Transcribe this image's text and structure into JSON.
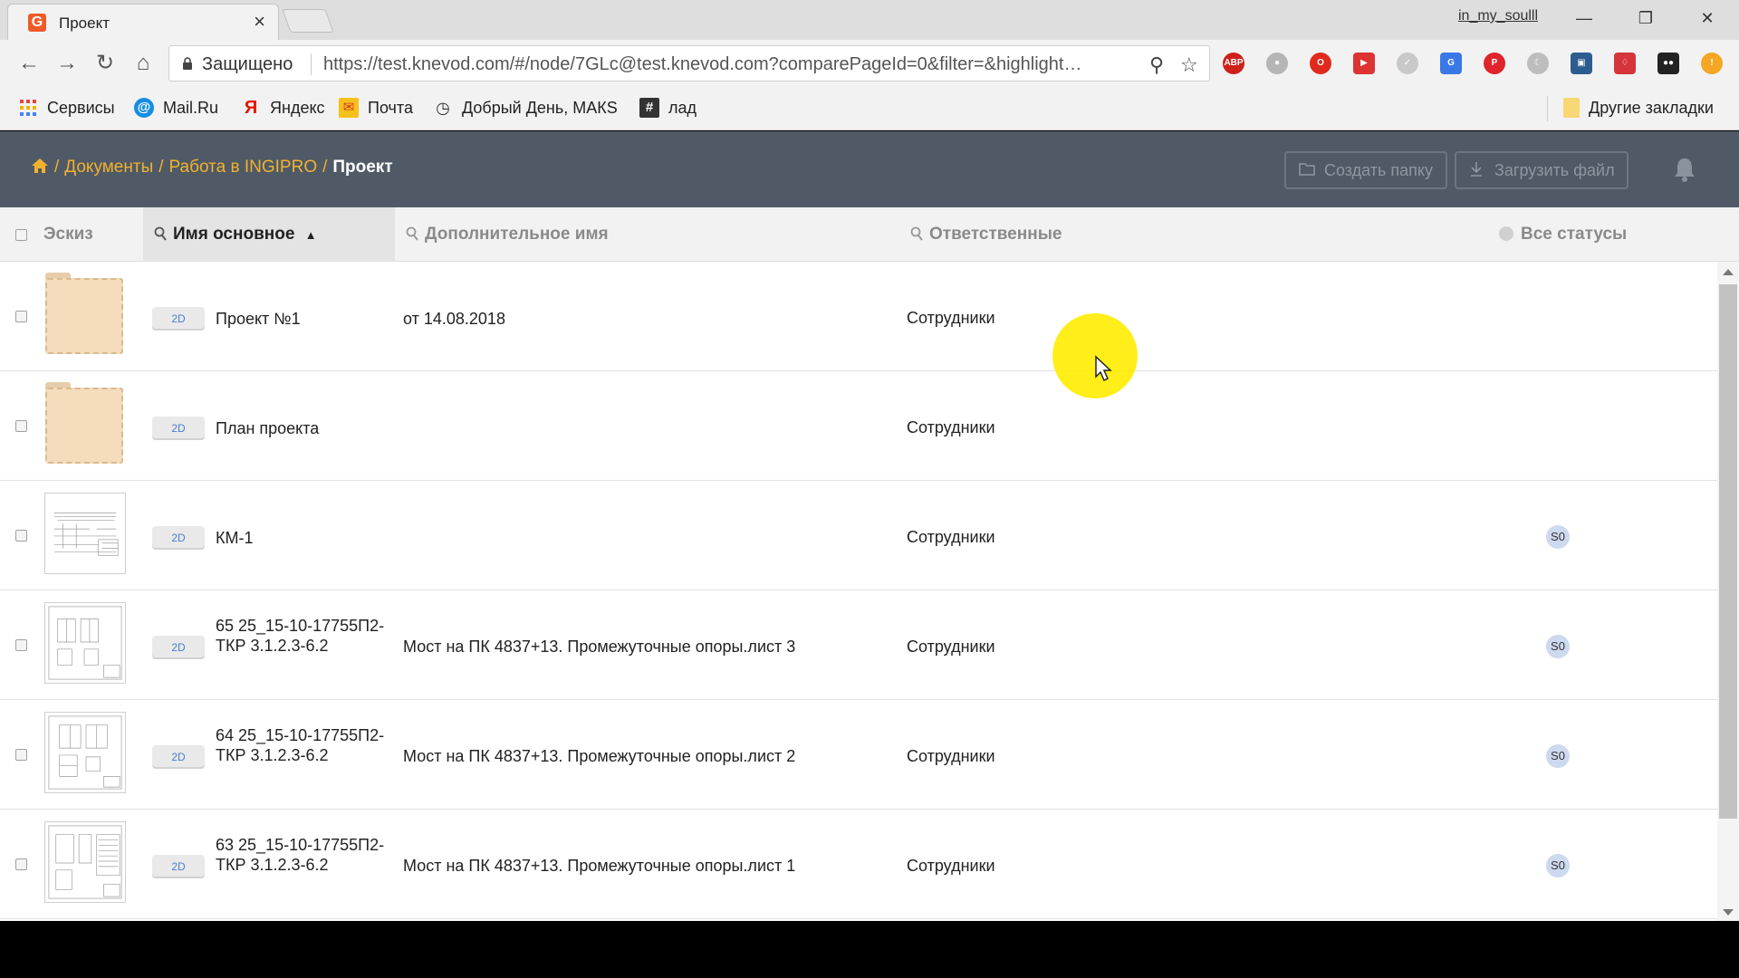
{
  "browser": {
    "tab_title": "Проект",
    "tab_close": "×",
    "favicon_letter": "G",
    "profile_name": "in_my_soulll",
    "secure_label": "Защищено",
    "url": "https://test.knevod.com/#/node/7GLc@test.knevod.com?comparePageId=0&filter=&highlight…",
    "extensions": [
      "abp-icon",
      "paw-icon",
      "opera-icon",
      "pdf-icon",
      "check-icon",
      "translate-icon",
      "pinterest-icon",
      "moon-icon",
      "screen-icon",
      "pocket-icon",
      "glasses-icon",
      "alert-icon"
    ],
    "bookmarks": [
      {
        "label": "Сервисы",
        "icon": "apps-grid-icon"
      },
      {
        "label": "Mail.Ru",
        "icon": "mailru-icon"
      },
      {
        "label": "Яндекс",
        "icon": "yandex-icon"
      },
      {
        "label": "Почта",
        "icon": "mail-icon"
      },
      {
        "label": "Добрый День, МАКS",
        "icon": "clock-icon"
      },
      {
        "label": "лад",
        "icon": "hash-icon"
      }
    ],
    "other_bookmarks": "Другие закладки"
  },
  "header": {
    "breadcrumbs": [
      "Документы",
      "Работа в INGIPRO"
    ],
    "breadcrumb_separator": "/",
    "current": "Проект",
    "create_folder_label": "Создать папку",
    "upload_file_label": "Загрузить файл"
  },
  "table": {
    "columns": {
      "sketch": "Эскиз",
      "name": "Имя основное",
      "extra": "Дополнительное имя",
      "responsible": "Ответственные",
      "statuses": "Все статусы"
    },
    "rows": [
      {
        "type": "folder",
        "badge": "2D",
        "name": "Проект №1",
        "extra": "от 14.08.2018",
        "responsible": "Сотрудники",
        "status": ""
      },
      {
        "type": "folder",
        "badge": "2D",
        "name": "План проекта",
        "extra": "",
        "responsible": "Сотрудники",
        "status": ""
      },
      {
        "type": "drawing",
        "badge": "2D",
        "name": "КМ-1",
        "extra": "",
        "responsible": "Сотрудники",
        "status": "S0"
      },
      {
        "type": "drawing",
        "badge": "2D",
        "name": "65 25_15-10-17755П2-ТКР 3.1.2.3-6.2",
        "extra": "Мост на ПК 4837+13. Промежуточные опоры.лист 3",
        "responsible": "Сотрудники",
        "status": "S0"
      },
      {
        "type": "drawing",
        "badge": "2D",
        "name": "64 25_15-10-17755П2-ТКР 3.1.2.3-6.2",
        "extra": "Мост на ПК 4837+13. Промежуточные опоры.лист 2",
        "responsible": "Сотрудники",
        "status": "S0"
      },
      {
        "type": "drawing",
        "badge": "2D",
        "name": "63 25_15-10-17755П2-ТКР 3.1.2.3-6.2",
        "extra": "Мост на ПК 4837+13. Промежуточные опоры.лист 1",
        "responsible": "Сотрудники",
        "status": "S0"
      }
    ]
  },
  "colors": {
    "header_bg": "#4f5a66",
    "breadcrumb": "#f3b12e",
    "folder": "#f5dcbd",
    "status_badge": "#cdd9ee",
    "cursor_highlight": "#ffec00"
  }
}
